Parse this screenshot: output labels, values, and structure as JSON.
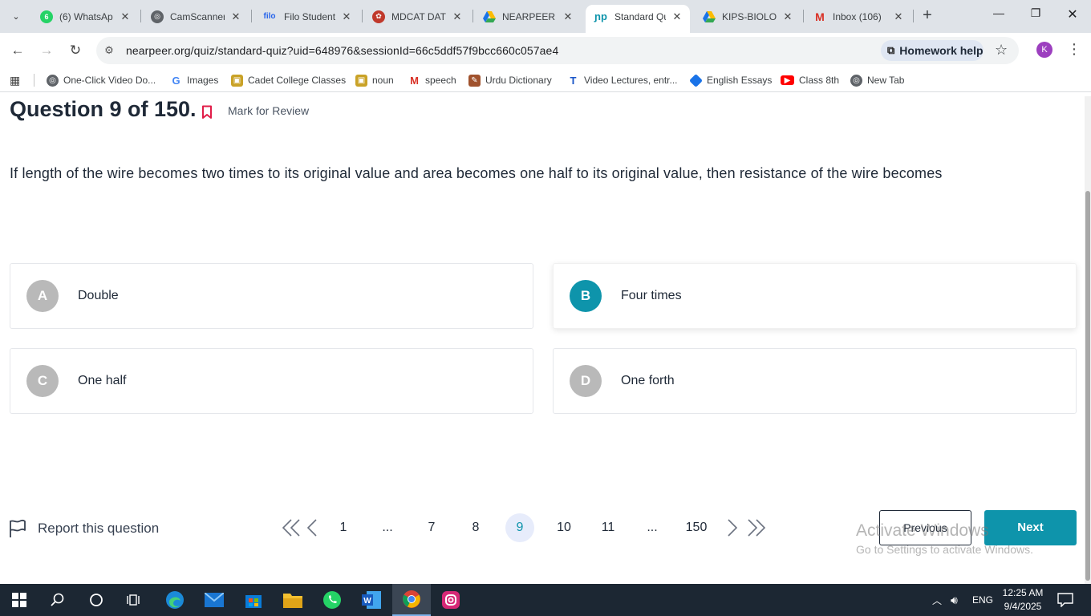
{
  "browser": {
    "tabs": [
      {
        "label": "(6) WhatsAp",
        "icon": "whatsapp-icon",
        "color": "#25d366"
      },
      {
        "label": "CamScanner",
        "icon": "globe-icon",
        "color": "#5f6368"
      },
      {
        "label": "Filo Student",
        "icon": "filo-icon",
        "color": "#2563eb"
      },
      {
        "label": "MDCAT DAT",
        "icon": "mdcat-icon",
        "color": "#c0392b"
      },
      {
        "label": "NEARPEER N",
        "icon": "drive-icon",
        "color": "#1a73e8"
      },
      {
        "label": "Standard Qu",
        "icon": "nearpeer-icon",
        "color": "#0e94ab"
      },
      {
        "label": "KIPS-BIOLO",
        "icon": "drive-icon",
        "color": "#fbbc04"
      },
      {
        "label": "Inbox (106)",
        "icon": "gmail-icon",
        "color": "#d93025"
      }
    ],
    "url": "nearpeer.org/quiz/standard-quiz?uid=648976&sessionId=66c5ddf57f9bcc660c057ae4",
    "homework_help": "Homework help",
    "profile_initial": "K",
    "bookmarks": [
      "One-Click Video Do...",
      "Images",
      "Cadet College Classes",
      "noun",
      "speech",
      "Urdu Dictionary",
      "Video Lectures, entr...",
      "English Essays",
      "Class 8th",
      "New Tab"
    ]
  },
  "quiz": {
    "title": "Question 9 of 150.",
    "mark_review": "Mark for Review",
    "question": "If length of the wire becomes two times to its original value and area becomes one half to its original value, then resistance of the wire becomes",
    "options": [
      {
        "letter": "A",
        "text": "Double"
      },
      {
        "letter": "B",
        "text": "Four times"
      },
      {
        "letter": "C",
        "text": "One half"
      },
      {
        "letter": "D",
        "text": "One forth"
      }
    ],
    "selected": "B",
    "report": "Report this question",
    "pages": [
      "1",
      "...",
      "7",
      "8",
      "9",
      "10",
      "11",
      "...",
      "150"
    ],
    "current_page": "9",
    "previous": "Previous",
    "next": "Next",
    "accent_color": "#0e94ab"
  },
  "watermark": {
    "line1": "Activate Windows",
    "line2": "Go to Settings to activate Windows."
  },
  "taskbar": {
    "lang": "ENG",
    "time": "12:25 AM",
    "date": "9/4/2025"
  }
}
